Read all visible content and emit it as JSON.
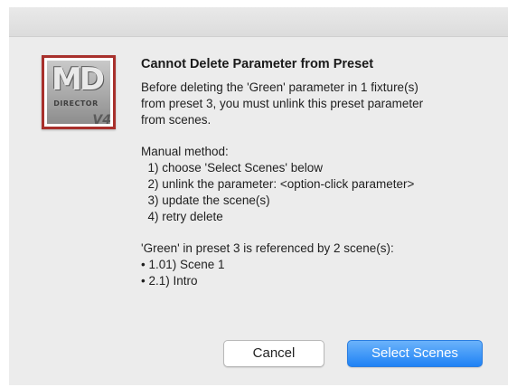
{
  "dialog": {
    "icon_text": "MD",
    "icon_subtext": "DIRECTOR",
    "icon_version": "V4",
    "title": "Cannot Delete Parameter from Preset",
    "message_lines": [
      "Before deleting the 'Green' parameter in 1 fixture(s)",
      "from preset 3, you must unlink this preset parameter",
      "from scenes."
    ],
    "method_lines": [
      "Manual method:",
      "  1) choose 'Select Scenes' below",
      "  2) unlink the parameter: <option-click parameter>",
      "  3) update the scene(s)",
      "  4) retry delete"
    ],
    "reference_lines": [
      "'Green' in preset 3 is referenced by 2 scene(s):",
      "• 1.01) Scene 1",
      "• 2.1) Intro"
    ],
    "buttons": {
      "cancel": "Cancel",
      "primary": "Select Scenes"
    },
    "colors": {
      "primary_button": "#1f82f5",
      "icon_border": "#a8302c",
      "dialog_bg": "#ececec"
    }
  }
}
